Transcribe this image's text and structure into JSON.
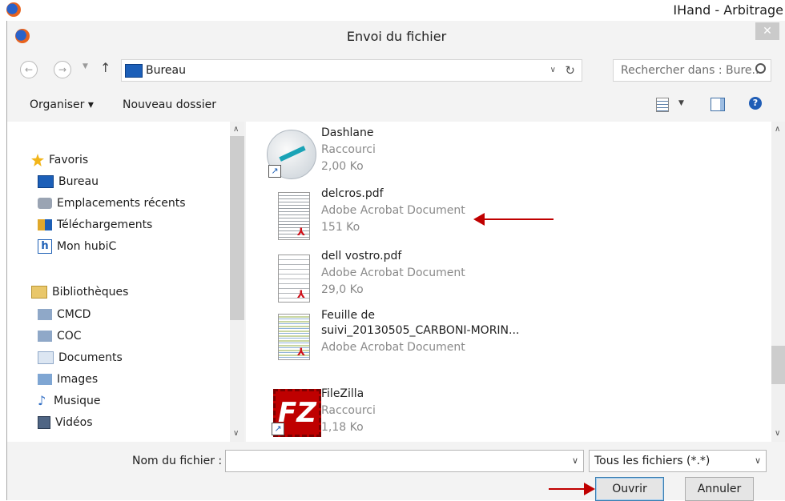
{
  "background_window": {
    "title": "IHand - Arbitrage"
  },
  "dialog": {
    "title": "Envoi du fichier",
    "close_label": "✕"
  },
  "address_bar": {
    "location": "Bureau"
  },
  "search": {
    "placeholder": "Rechercher dans : Bure..."
  },
  "toolbar": {
    "organize_label": "Organiser ▾",
    "new_folder_label": "Nouveau dossier"
  },
  "nav_pane": {
    "favorites_header": "Favoris",
    "favorites": [
      "Bureau",
      "Emplacements récents",
      "Téléchargements",
      "Mon hubiC"
    ],
    "libraries_header": "Bibliothèques",
    "libraries": [
      "CMCD",
      "COC",
      "Documents",
      "Images",
      "Musique",
      "Vidéos"
    ]
  },
  "files": [
    {
      "name": "Dashlane",
      "type": "Raccourci",
      "size": "2,00 Ko"
    },
    {
      "name": "delcros.pdf",
      "type": "Adobe Acrobat Document",
      "size": "151 Ko"
    },
    {
      "name": "dell vostro.pdf",
      "type": "Adobe Acrobat Document",
      "size": "29,0 Ko"
    },
    {
      "name": "Feuille de",
      "name_line2": "suivi_20130505_CARBONI-MORIN...",
      "type": "Adobe Acrobat Document"
    },
    {
      "name": "FileZilla",
      "type": "Raccourci",
      "size": "1,18 Ko"
    }
  ],
  "bottom": {
    "filename_label": "Nom du fichier :",
    "filename_value": "",
    "filter_value": "Tous les fichiers (*.*)",
    "open_label": "Ouvrir",
    "cancel_label": "Annuler"
  },
  "colors": {
    "arrow": "#c00000",
    "folder_blue": "#1c5fb8"
  }
}
